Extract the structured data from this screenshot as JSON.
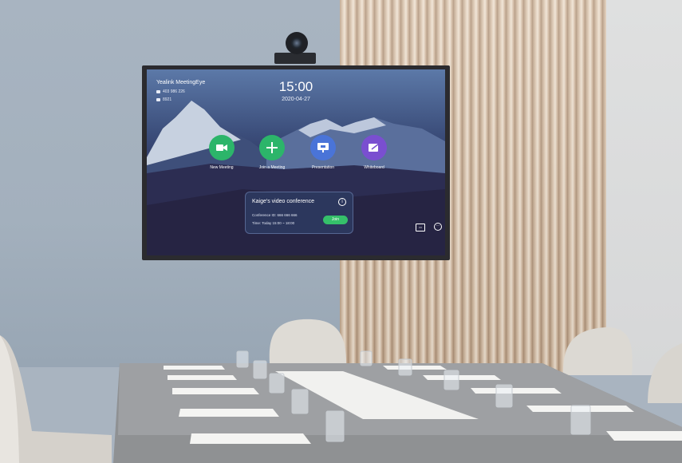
{
  "screen": {
    "brand": "Yealink MeetingEye",
    "id_line": "403 986 226",
    "ext_line": "8921",
    "time": "15:00",
    "date": "2020-04-27",
    "apps": [
      {
        "label": "New Meeting",
        "color": "#2cb56a",
        "icon": "video-camera-icon"
      },
      {
        "label": "Join a Meeting",
        "color": "#2cb56a",
        "icon": "plus-icon"
      },
      {
        "label": "Presentation",
        "color": "#4a74d8",
        "icon": "presentation-icon"
      },
      {
        "label": "Whiteboard",
        "color": "#7a4fd0",
        "icon": "whiteboard-icon"
      }
    ],
    "meeting_card": {
      "title": "Kaige's video conference",
      "conference_id": "Conference ID:  666 666 666",
      "time": "Time:  Today 15:00 ~ 18:00",
      "join_label": "Join"
    },
    "corner_icons": [
      "layout-icon",
      "more-icon"
    ]
  }
}
